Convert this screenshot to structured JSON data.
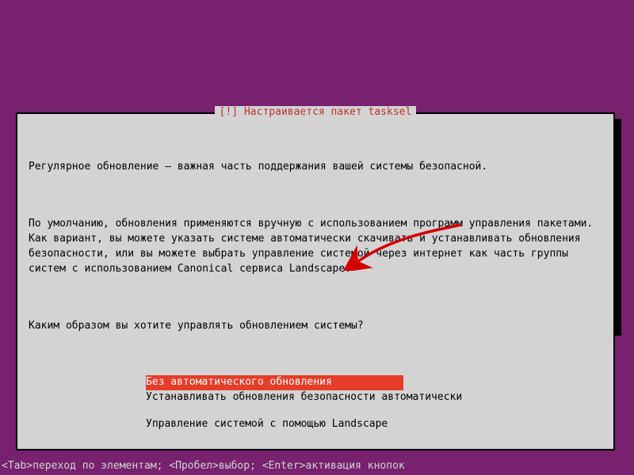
{
  "dialog": {
    "title": "[!] Настраивается пакет tasksel",
    "paragraph1": "Регулярное обновление – важная часть поддержания вашей системы безопасной.",
    "paragraph2": "По умолчанию, обновления применяются вручную с использованием программ управления пакетами. Как вариант, вы можете указать системе автоматически скачивать и устанавливать обновления безопасности, или вы можете выбрать управление системой через интернет как часть группы систем с использованием Canonical сервиса Landscape.",
    "question": "Каким образом вы хотите управлять обновлением системы?",
    "options": [
      "Без автоматического обновления",
      "Устанавливать обновления безопасности автоматически",
      "Управление системой с помощью Landscape"
    ],
    "selected_index": 0
  },
  "footer": "<Tab>переход по элементам; <Пробел>выбор; <Enter>активация кнопок",
  "colors": {
    "background": "#77216F",
    "dialog_bg": "#d3d3d3",
    "title_accent": "#c03030",
    "selected_bg": "#e63c28",
    "arrow": "#d40000"
  }
}
